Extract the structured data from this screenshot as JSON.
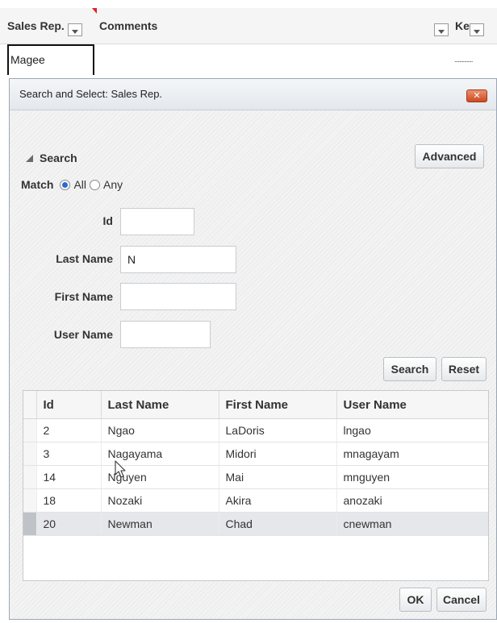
{
  "background_table": {
    "headers": {
      "sales_rep": "Sales Rep.",
      "comments": "Comments",
      "ke": "Ke"
    },
    "row": {
      "sales_rep": "Magee",
      "trailing": "..............."
    }
  },
  "dialog": {
    "title": "Search and Select: Sales Rep.",
    "close_label": "✕",
    "search_heading": "Search",
    "advanced_label": "Advanced",
    "match": {
      "label": "Match",
      "options": [
        "All",
        "Any"
      ],
      "selected": "All"
    },
    "fields": {
      "id": {
        "label": "Id",
        "value": ""
      },
      "last_name": {
        "label": "Last Name",
        "value": "N"
      },
      "first_name": {
        "label": "First Name",
        "value": ""
      },
      "user_name": {
        "label": "User Name",
        "value": ""
      }
    },
    "search_button": "Search",
    "reset_button": "Reset",
    "results": {
      "columns": [
        "Id",
        "Last Name",
        "First Name",
        "User Name"
      ],
      "rows": [
        [
          "2",
          "Ngao",
          "LaDoris",
          "lngao"
        ],
        [
          "3",
          "Nagayama",
          "Midori",
          "mnagayam"
        ],
        [
          "14",
          "Nguyen",
          "Mai",
          "mnguyen"
        ],
        [
          "18",
          "Nozaki",
          "Akira",
          "anozaki"
        ],
        [
          "20",
          "Newman",
          "Chad",
          "cnewman"
        ]
      ],
      "selected_row_index": 4
    },
    "ok_button": "OK",
    "cancel_button": "Cancel"
  },
  "colors": {
    "close_button": "#d9592e",
    "radio_selected": "#2a6bd1",
    "required_marker": "#e0202a"
  }
}
